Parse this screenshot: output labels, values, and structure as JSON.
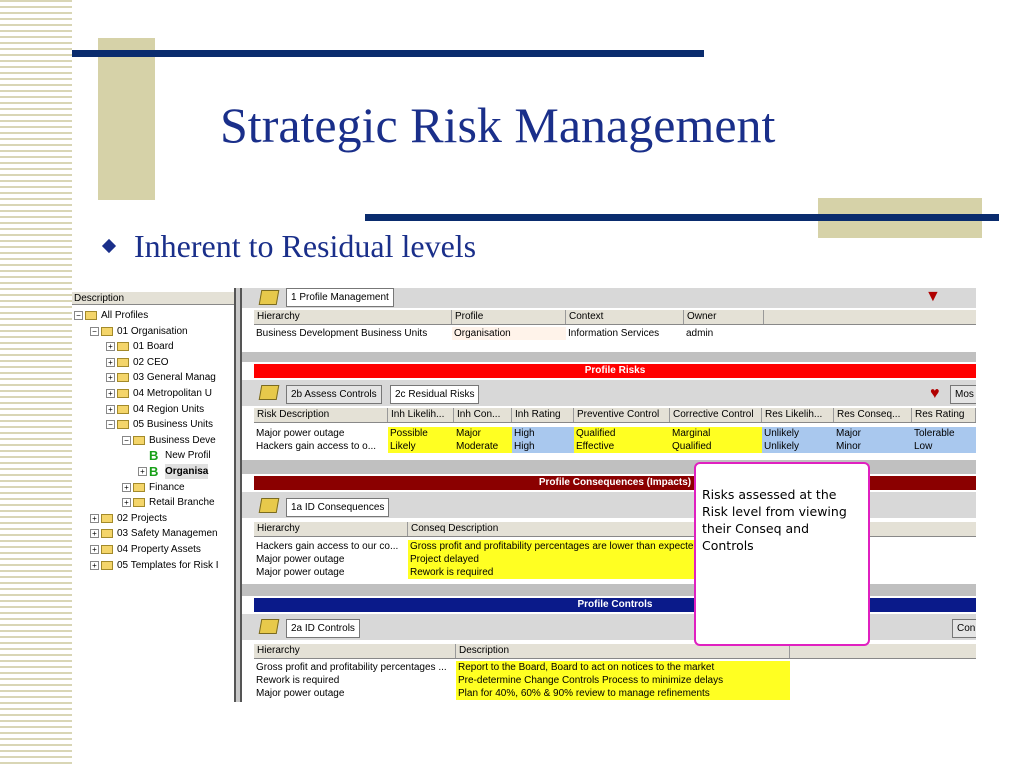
{
  "slide": {
    "title": "Strategic Risk Management",
    "bullet": "Inherent to Residual levels"
  },
  "tree": {
    "header": "Description",
    "nodes": [
      {
        "label": "All Profiles",
        "expander": "−",
        "icon": "folder"
      },
      {
        "label": "01 Organisation",
        "expander": "−",
        "icon": "folder"
      },
      {
        "label": "01  Board",
        "expander": "+",
        "icon": "folder"
      },
      {
        "label": "02  CEO",
        "expander": "+",
        "icon": "folder"
      },
      {
        "label": "03  General Manag",
        "expander": "+",
        "icon": "folder"
      },
      {
        "label": "04  Metropolitan U",
        "expander": "+",
        "icon": "folder"
      },
      {
        "label": "04  Region Units",
        "expander": "+",
        "icon": "folder"
      },
      {
        "label": "05  Business Units",
        "expander": "−",
        "icon": "folder"
      },
      {
        "label": "Business Deve",
        "expander": "−",
        "icon": "folder"
      },
      {
        "label": "New Profil",
        "expander": "",
        "icon": "B"
      },
      {
        "label": "Organisa",
        "expander": "+",
        "icon": "B"
      },
      {
        "label": "Finance",
        "expander": "+",
        "icon": "folder"
      },
      {
        "label": "Retail Branche",
        "expander": "+",
        "icon": "folder"
      },
      {
        "label": "02 Projects",
        "expander": "+",
        "icon": "folder"
      },
      {
        "label": "03 Safety Managemen",
        "expander": "+",
        "icon": "folder"
      },
      {
        "label": "04 Property Assets",
        "expander": "+",
        "icon": "folder"
      },
      {
        "label": "05 Templates for Risk I",
        "expander": "+",
        "icon": "folder"
      }
    ]
  },
  "profile_mgmt": {
    "tab": "1 Profile Management",
    "columns": [
      "Hierarchy",
      "Profile",
      "Context",
      "Owner"
    ],
    "row": [
      "Business Development Business Units",
      "Organisation",
      "Information Services",
      "admin"
    ]
  },
  "profile_risks": {
    "title": "Profile Risks",
    "tabs": [
      "2b Assess Controls",
      "2c Residual Risks"
    ],
    "right_button": "Mos",
    "columns": [
      "Risk Description",
      "Inh Likelih...",
      "Inh Con...",
      "Inh Rating",
      "Preventive Control",
      "Corrective Control",
      "Res Likelih...",
      "Res Conseq...",
      "Res Rating"
    ],
    "rows": [
      [
        "Major power outage",
        "Possible",
        "Major",
        "High",
        "Qualified",
        "Marginal",
        "Unlikely",
        "Major",
        "Tolerable"
      ],
      [
        "Hackers gain access to o...",
        "Likely",
        "Moderate",
        "High",
        "Effective",
        "Qualified",
        "Unlikely",
        "Minor",
        "Low"
      ]
    ]
  },
  "consequences": {
    "title": "Profile Consequences (Impacts)",
    "tab": "1a ID Consequences",
    "columns": [
      "Hierarchy",
      "Conseq Description"
    ],
    "rows": [
      [
        "Hackers gain access to our co...",
        "Gross profit and profitability percentages are lower than expected"
      ],
      [
        "Major power outage",
        "Project delayed"
      ],
      [
        "Major power outage",
        "Rework is required"
      ]
    ]
  },
  "controls": {
    "title": "Profile Controls",
    "tab": "2a  ID Controls",
    "right_button": "Con",
    "columns": [
      "Hierarchy",
      "Description"
    ],
    "rows": [
      [
        "Gross profit and profitability percentages ...",
        "Report to the Board, Board to act on notices to the market"
      ],
      [
        "Rework is required",
        "Pre-determine Change Controls Process to minimize delays"
      ],
      [
        "Major power outage",
        "Plan for 40%, 60% & 90% review to manage refinements"
      ]
    ]
  },
  "callout": {
    "text": "Risks assessed at the Risk level from viewing their Conseq and Controls"
  },
  "colors": {
    "title": "#1a2f8a",
    "risks_bar": "#ff0000",
    "consequences_bar": "#8b0000",
    "controls_bar": "#0a1a8a",
    "highlight_yellow": "#ffff22",
    "highlight_blue": "#a9c8ee",
    "callout_border": "#e020c0"
  }
}
